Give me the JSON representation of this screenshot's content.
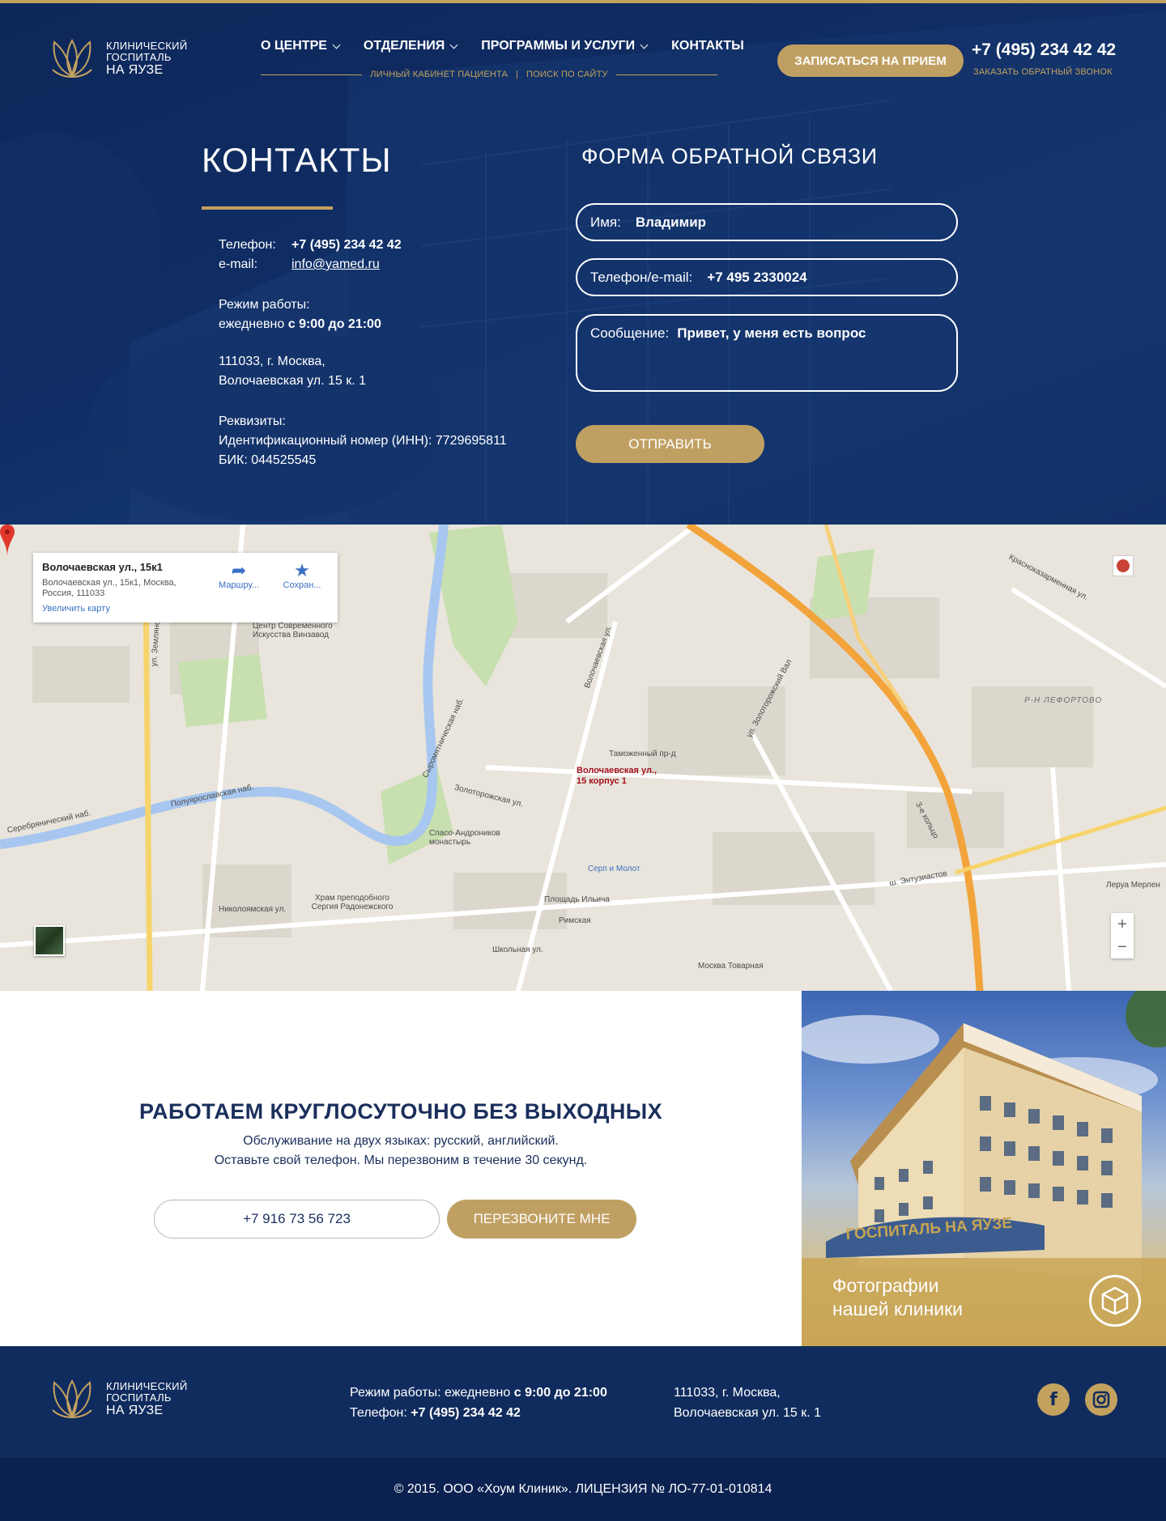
{
  "logo": {
    "line1": "КЛИНИЧЕСКИЙ",
    "line2": "ГОСПИТАЛЬ",
    "line3": "НА ЯУЗЕ"
  },
  "nav": {
    "items": [
      {
        "label": "О ЦЕНТРЕ",
        "dropdown": true
      },
      {
        "label": "ОТДЕЛЕНИЯ",
        "dropdown": true
      },
      {
        "label": "ПРОГРАММЫ И УСЛУГИ",
        "dropdown": true
      },
      {
        "label": "КОНТАКТЫ",
        "dropdown": false
      }
    ],
    "sub_cabinet": "Личный кабинет пациента",
    "sub_sep": "|",
    "sub_search": "Поиск по сайту"
  },
  "header": {
    "appoint_label": "ЗАПИСАТЬСЯ НА ПРИЕМ",
    "phone": "+7 (495) 234 42 42",
    "callback_label": "ЗАКАЗАТЬ ОБРАТНЫЙ ЗВОНОК"
  },
  "contacts": {
    "title": "КОНТАКТЫ",
    "phone_label": "Телефон:",
    "phone_value": "+7 (495) 234 42 42",
    "email_label": "e-mail:",
    "email_value": "info@yamed.ru",
    "hours_label": "Режим работы:",
    "hours_prefix": "ежедневно",
    "hours_value": "с 9:00 до 21:00",
    "address_line1": "111033, г. Москва,",
    "address_line2": "Волочаевская ул. 15 к. 1",
    "req_label": "Реквизиты:",
    "req_inn": "Идентификационный номер (ИНН): 7729695811",
    "req_bik": "БИК: 044525545"
  },
  "form": {
    "title": "ФОРМА ОБРАТНОЙ СВЯЗИ",
    "name_label": "Имя:",
    "name_value": "Владимир",
    "contact_label": "Телефон/e-mail:",
    "contact_value": "+7 495 2330024",
    "message_label": "Сообщение:",
    "message_value": "Привет, у меня  есть вопрос",
    "submit_label": "ОТПРАВИТЬ"
  },
  "map": {
    "card_title": "Волочаевская ул., 15к1",
    "card_address": "Волочаевская ул., 15к1, Москва, Россия, 111033",
    "card_zoom": "Увеличить карту",
    "route_label": "Маршру...",
    "save_label": "Сохран...",
    "pin_label": "Волочаевская ул., 15 корпус 1",
    "zoom_in": "+",
    "zoom_out": "−",
    "labels": [
      "ул. Земляной Вал",
      "Полуярославская наб.",
      "Николоямская ул.",
      "Серебрянический наб.",
      "Спасо-Андроников монастырь",
      "Золоторожская ул.",
      "Таможенный пр-д",
      "Серп и Молот",
      "Площадь Ильича",
      "Римская",
      "Москва Товарная",
      "ш. Энтузиастов",
      "Р-Н ЛЕФОРТОВО",
      "3-е кольцо",
      "Леруа Мерлен",
      "Центр Современного Искусства Винзавод",
      "Храм преподобного Сергия Радонежского",
      "Волочаевская ул.",
      "ул. Золоторожский Вал",
      "Красноказарменная ул.",
      "Школьная ул.",
      "Сыромятническая наб."
    ]
  },
  "callback_section": {
    "title": "РАБОТАЕМ КРУГЛОСУТОЧНО БЕЗ ВЫХОДНЫХ",
    "line1": "Обслуживание на двух языках: русский, английский.",
    "line2": "Оставьте свой телефон. Мы перезвоним в течение 30 секунд.",
    "phone_value": "+7 916 73 56 723",
    "button_label": "ПЕРЕЗВОНИТЕ МНЕ"
  },
  "photo": {
    "caption_line1": "Фотографии",
    "caption_line2": "нашей клиники",
    "sign": "ГОСПИТАЛЬ НА ЯУЗЕ"
  },
  "footer": {
    "hours_prefix": "Режим работы: ежедневно",
    "hours_value": "с 9:00 до 21:00",
    "phone_prefix": "Телефон:",
    "phone_value": "+7 (495) 234 42 42",
    "address_line1": "111033, г. Москва,",
    "address_line2": "Волочаевская ул. 15 к. 1",
    "copyright": "© 2015. ООО «Хоум Клиник».  ЛИЦЕНЗИЯ № ЛО-77-01-010814"
  },
  "colors": {
    "navy": "#102c5e",
    "gold": "#c3a25e",
    "hero_overlay": "#123670"
  },
  "icons": [
    "logo-lotus-icon",
    "chevron-down-icon",
    "route-icon",
    "star-icon",
    "map-pin-icon",
    "cube-icon",
    "facebook-icon",
    "instagram-icon"
  ]
}
